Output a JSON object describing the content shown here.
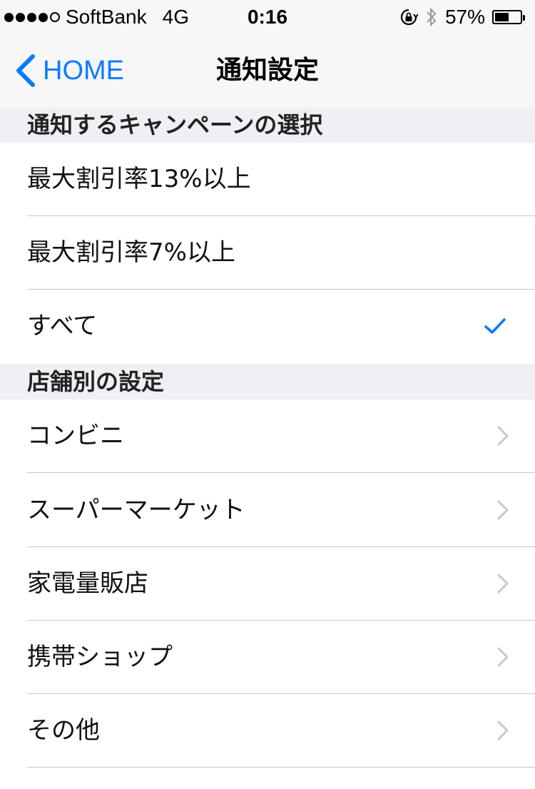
{
  "status_bar": {
    "carrier": "SoftBank",
    "network": "4G",
    "time": "0:16",
    "battery_percent": "57%",
    "battery_level": 0.57,
    "signal_bars": 4
  },
  "nav": {
    "back_label": "HOME",
    "title": "通知設定"
  },
  "sections": [
    {
      "header": "通知するキャンペーンの選択",
      "rows": [
        {
          "label": "最大割引率13%以上",
          "selected": false
        },
        {
          "label": "最大割引率7%以上",
          "selected": false
        },
        {
          "label": "すべて",
          "selected": true
        }
      ]
    },
    {
      "header": "店舗別の設定",
      "rows": [
        {
          "label": "コンビニ"
        },
        {
          "label": "スーパーマーケット"
        },
        {
          "label": "家電量販店"
        },
        {
          "label": "携帯ショップ"
        },
        {
          "label": "その他"
        }
      ]
    }
  ],
  "colors": {
    "accent": "#0a7bff",
    "section_bg": "#efeff4",
    "chevron": "#c7c7cc"
  }
}
